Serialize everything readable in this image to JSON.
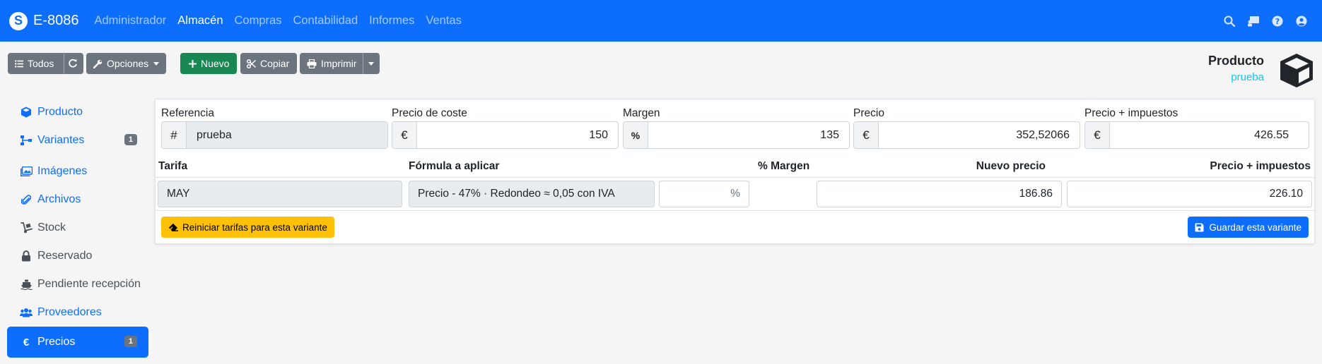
{
  "app": {
    "brand": "E-8086"
  },
  "nav": {
    "items": [
      {
        "label": "Administrador",
        "active": false
      },
      {
        "label": "Almacén",
        "active": true
      },
      {
        "label": "Compras",
        "active": false
      },
      {
        "label": "Contabilidad",
        "active": false
      },
      {
        "label": "Informes",
        "active": false
      },
      {
        "label": "Ventas",
        "active": false
      }
    ],
    "icons": [
      "search-icon",
      "chalkboard-icon",
      "help-icon",
      "user-icon"
    ]
  },
  "toolbar": {
    "all_label": "Todos",
    "options_label": "Opciones",
    "new_label": "Nuevo",
    "copy_label": "Copiar",
    "print_label": "Imprimir"
  },
  "header": {
    "title": "Producto",
    "subtitle": "prueba"
  },
  "sidebar": {
    "items": [
      {
        "label": "Producto",
        "icon": "cube-icon"
      },
      {
        "label": "Variantes",
        "icon": "sitemap-icon",
        "badge": "1"
      },
      {
        "label": "Imágenes",
        "icon": "images-icon"
      },
      {
        "label": "Archivos",
        "icon": "paperclip-icon"
      },
      {
        "label": "Stock",
        "icon": "dolly-icon"
      },
      {
        "label": "Reservado",
        "icon": "lock-icon"
      },
      {
        "label": "Pendiente recepción",
        "icon": "ship-icon"
      },
      {
        "label": "Proveedores",
        "icon": "users-icon"
      },
      {
        "label": "Precios",
        "icon": "euro-icon",
        "badge": "1",
        "active": true
      }
    ]
  },
  "variant": {
    "reference": {
      "label": "Referencia",
      "addon": "#",
      "value": "prueba"
    },
    "cost": {
      "label": "Precio de coste",
      "addon": "€",
      "value": "150"
    },
    "margin": {
      "label": "Margen",
      "addon": "%",
      "value": "135"
    },
    "price": {
      "label": "Precio",
      "addon": "€",
      "value": "352,52066"
    },
    "price_tax": {
      "label": "Precio + impuestos",
      "addon": "€",
      "value": "426.55"
    }
  },
  "rates_table": {
    "headers": {
      "rate": "Tarifa",
      "formula": "Fórmula a aplicar",
      "margin": "% Margen",
      "new_price": "Nuevo precio",
      "price_tax": "Precio + impuestos"
    },
    "rows": [
      {
        "rate": "MAY",
        "formula": "Precio - 47% · Redondeo ≈ 0,05 con IVA",
        "margin_suffix": "%",
        "new_price": "186.86",
        "price_tax": "226.10"
      }
    ]
  },
  "actions": {
    "reset_label": "Reiniciar tarifas para esta variante",
    "save_label": "Guardar esta variante"
  },
  "colors": {
    "primary": "#0d6efd",
    "success": "#198754",
    "secondary": "#6c757d",
    "warning": "#ffc107",
    "info": "#0dcaf0"
  }
}
